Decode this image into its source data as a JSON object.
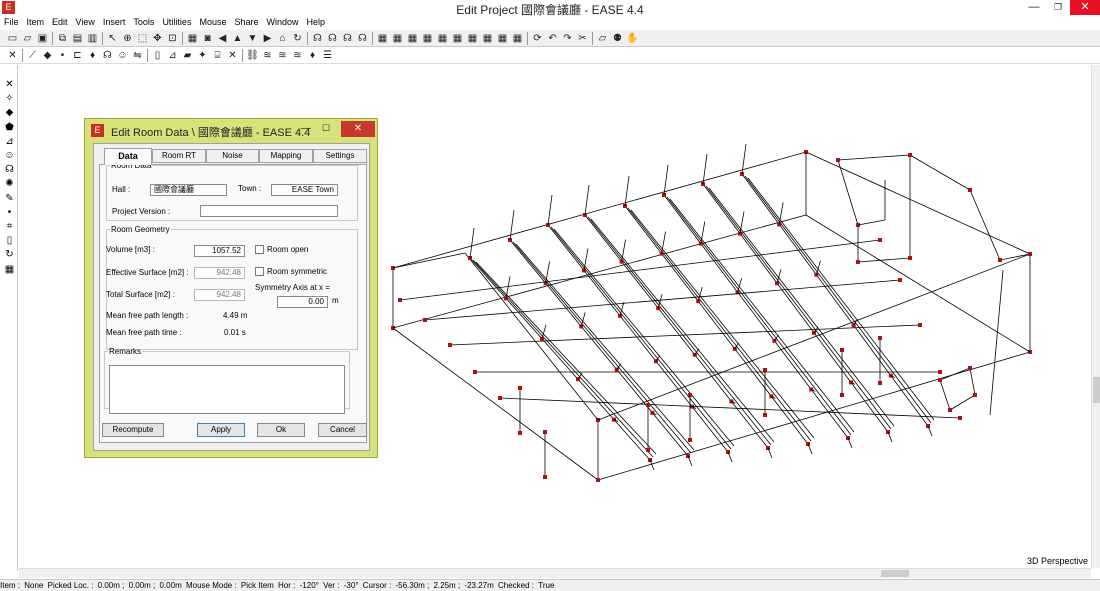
{
  "window": {
    "title": "Edit Project 國際會議廳 - EASE 4.4",
    "icon": "app-logo-icon",
    "controls": {
      "minimize": "—",
      "restore": "❐",
      "close": "✕"
    }
  },
  "menu": [
    "File",
    "Item",
    "Edit",
    "View",
    "Insert",
    "Tools",
    "Utilities",
    "Mouse",
    "Share",
    "Window",
    "Help"
  ],
  "toolbar1_icons": [
    "open-icon",
    "open-folder-icon",
    "save-icon",
    "copy-icon",
    "paste-icon",
    "print-icon",
    "pointer-icon",
    "crosshair-icon",
    "select-icon",
    "move-icon",
    "zoom-fit-icon",
    "grid-icon",
    "camera-icon",
    "arrow-left-icon",
    "arrow-up-icon",
    "arrow-down-icon",
    "arrow-right-icon",
    "home-icon",
    "refresh-icon",
    "speaker-icon",
    "speaker-icon",
    "speaker-icon",
    "speaker-icon",
    "window-1-icon",
    "window-2-icon",
    "window-3-icon",
    "window-4-icon",
    "window-5-icon",
    "window-6-icon",
    "window-7-icon",
    "window-8-icon",
    "window-9-icon",
    "window-10-icon",
    "rotate-icon",
    "undo-icon",
    "redo-icon",
    "cut-icon",
    "plane-icon",
    "group-icon",
    "hand-icon"
  ],
  "toolbar2_icons": [
    "close-icon",
    "line-icon",
    "face-icon",
    "vertex-icon",
    "edge-icon",
    "bulb-icon",
    "speaker-icon",
    "audience-icon",
    "mirror-icon",
    "wall-icon",
    "stairs-icon",
    "surface-icon",
    "lamp-icon",
    "seats-icon",
    "cross-icon",
    "link-icon",
    "layer-icon",
    "layer-icon",
    "layer-icon",
    "bulb-icon",
    "list-icon"
  ],
  "left_toolbar_icons": [
    "close-icon",
    "wand-icon",
    "face-icon",
    "shape-icon",
    "stairs-icon",
    "audience-icon",
    "speaker-icon",
    "light-icon",
    "edit-icon",
    "vertex-icon",
    "crop-icon",
    "door-icon",
    "refresh-icon",
    "grid-icon"
  ],
  "dialog": {
    "title": "Edit Room Data \\ 國際會議廳 - EASE 4.4",
    "controls": {
      "minimize": "—",
      "maximize": "☐",
      "close": "✕"
    },
    "tabs": [
      "Data",
      "Room RT",
      "Noise",
      "Mapping",
      "Settings"
    ],
    "active_tab": "Data",
    "room_data": {
      "legend": "Room Data",
      "hall_label": "Hall :",
      "hall_value": "國際會議廳",
      "town_label": "Town :",
      "town_value": "EASE Town",
      "version_label": "Project Version :",
      "version_value": ""
    },
    "room_geometry": {
      "legend": "Room Geometry",
      "volume_label": "Volume [m3] :",
      "volume_value": "1057.52",
      "eff_surface_label": "Effective Surface [m2] :",
      "eff_surface_value": "942.48",
      "total_surface_label": "Total Surface [m2] :",
      "total_surface_value": "942.48",
      "mfp_length_label": "Mean free path length :",
      "mfp_length_value": "4.49 m",
      "mfp_time_label": "Mean free path time :",
      "mfp_time_value": "0.01 s",
      "room_open_label": "Room open",
      "room_symmetric_label": "Room symmetric",
      "symmetry_axis_label": "Symmetry Axis at x =",
      "symmetry_axis_value": "0.00",
      "symmetry_axis_unit": "m"
    },
    "remarks": {
      "legend": "Remarks",
      "value": ""
    },
    "buttons": {
      "recompute": "Recompute",
      "apply": "Apply",
      "ok": "Ok",
      "cancel": "Cancel"
    }
  },
  "viewport": {
    "label": "3D Perspective"
  },
  "statusbar": {
    "item_label": "Item :",
    "item_value": "None",
    "picked_label": "Picked Loc. :",
    "picked_x": "0.00m ;",
    "picked_y": "0.00m ;",
    "picked_z": "0.00m",
    "mouse_mode_label": "Mouse Mode :",
    "mouse_mode_value": "Pick Item",
    "hor_label": "Hor :",
    "hor_value": "-120°",
    "ver_label": "Ver :",
    "ver_value": "-30°",
    "cursor_label": "Cursor :",
    "cursor_x": "-56.30m ;",
    "cursor_y": "2.25m ;",
    "cursor_z": "-23.27m",
    "checked_label": "Checked :",
    "checked_value": "True"
  },
  "colors": {
    "dialog_frame": "#d7e27a",
    "vertex_marker": "#b01010",
    "close_button": "#e81123"
  }
}
